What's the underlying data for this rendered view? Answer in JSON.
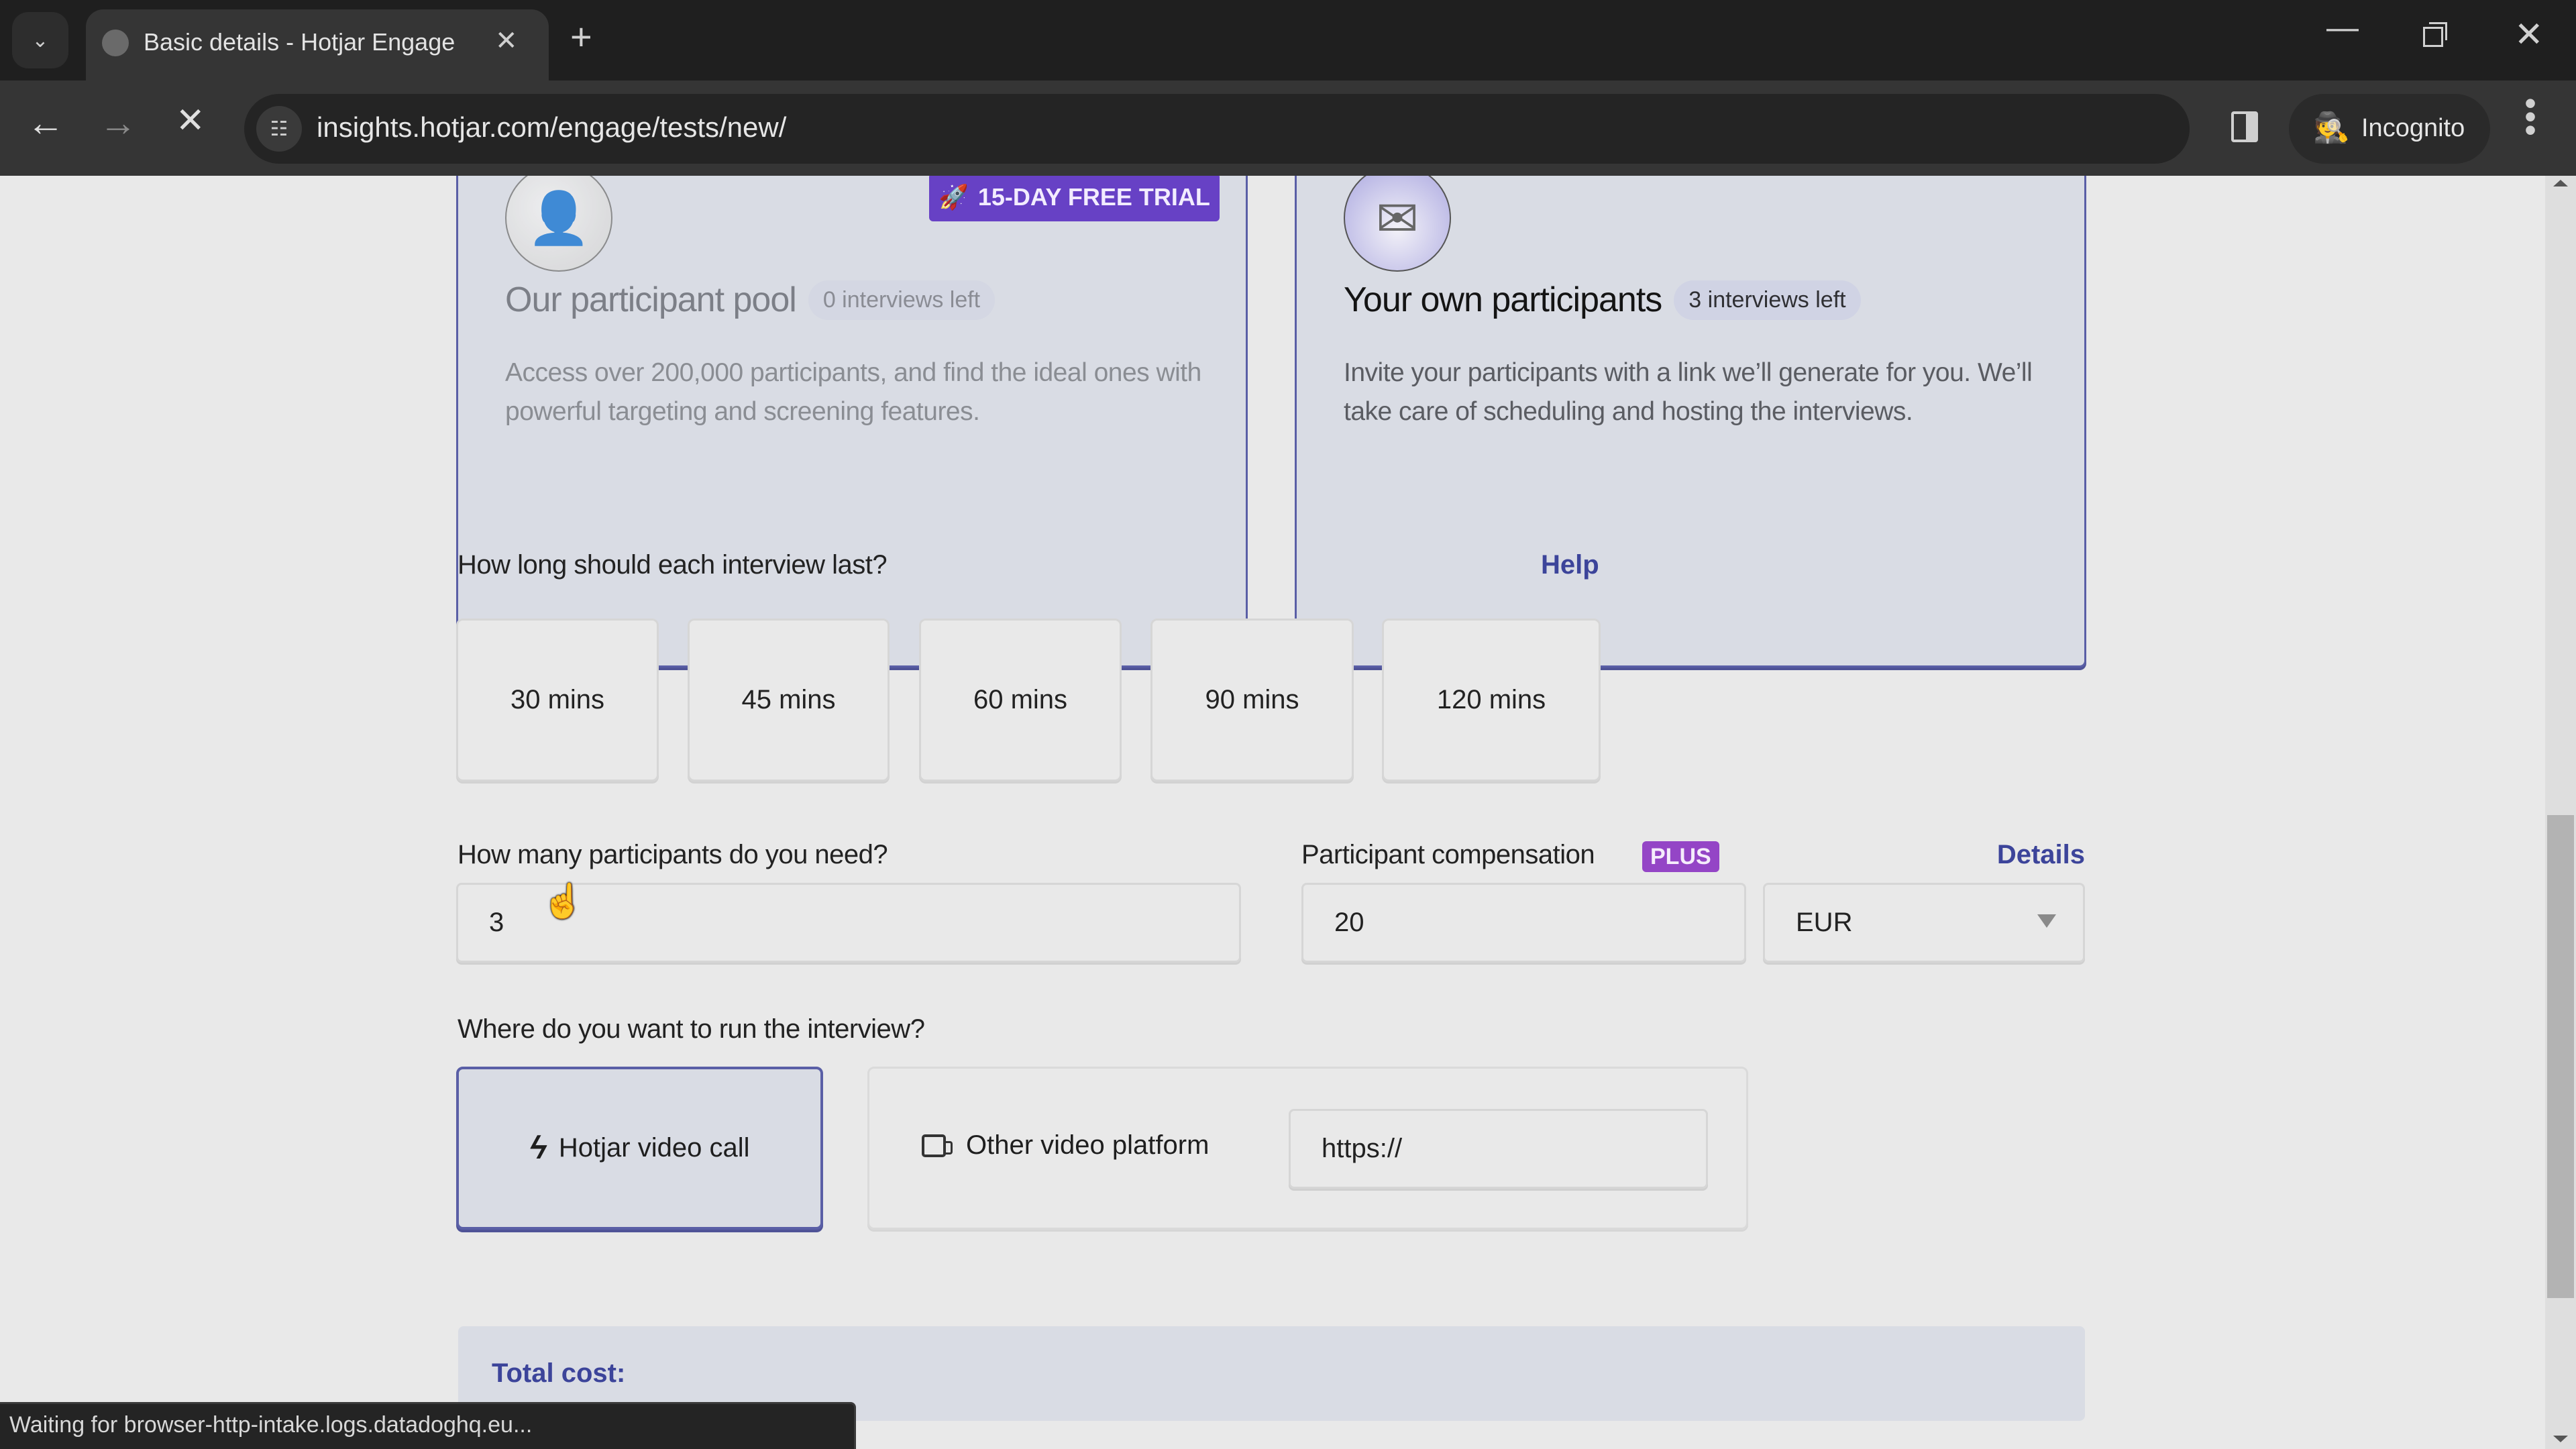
{
  "browser": {
    "tab_title": "Basic details - Hotjar Engage",
    "url": "insights.hotjar.com/engage/tests/new/",
    "profile_label": "Incognito",
    "status_text": "Waiting for browser-http-intake.logs.datadoghq.eu..."
  },
  "icons": {
    "tab_list": "⌄",
    "close": "✕",
    "new_tab": "+",
    "minimize": "—",
    "back": "←",
    "forward": "→",
    "stop": "✕",
    "site_info": "☷",
    "bookmark": "☆",
    "incognito": "🕵",
    "menu": "⋮",
    "rocket": "🚀",
    "pool_illustration": "👤",
    "own_illustration": "✉",
    "hotjar_logo": "ϟ",
    "cursor": "☝"
  },
  "participant_source": {
    "pool": {
      "badge": "15-DAY FREE TRIAL",
      "title": "Our participant pool",
      "remaining": "0 interviews left",
      "description": "Access over 200,000 participants, and find the ideal ones with powerful targeting and screening features."
    },
    "own": {
      "title": "Your own participants",
      "remaining": "3 interviews left",
      "description": "Invite your participants with a link we’ll generate for you. We’ll take care of scheduling and hosting the interviews."
    }
  },
  "duration": {
    "label": "How long should each interview last?",
    "help_link": "Help",
    "options": [
      "30 mins",
      "45 mins",
      "60 mins",
      "90 mins",
      "120 mins"
    ]
  },
  "participants": {
    "label": "How many participants do you need?",
    "value": "3"
  },
  "compensation": {
    "label": "Participant compensation",
    "plan_badge": "PLUS",
    "details_link": "Details",
    "amount": "20",
    "currency": "EUR"
  },
  "location": {
    "label": "Where do you want to run the interview?",
    "hotjar_option": "Hotjar video call",
    "other_option": "Other video platform",
    "url_placeholder": "https://"
  },
  "total": {
    "label": "Total cost:"
  }
}
